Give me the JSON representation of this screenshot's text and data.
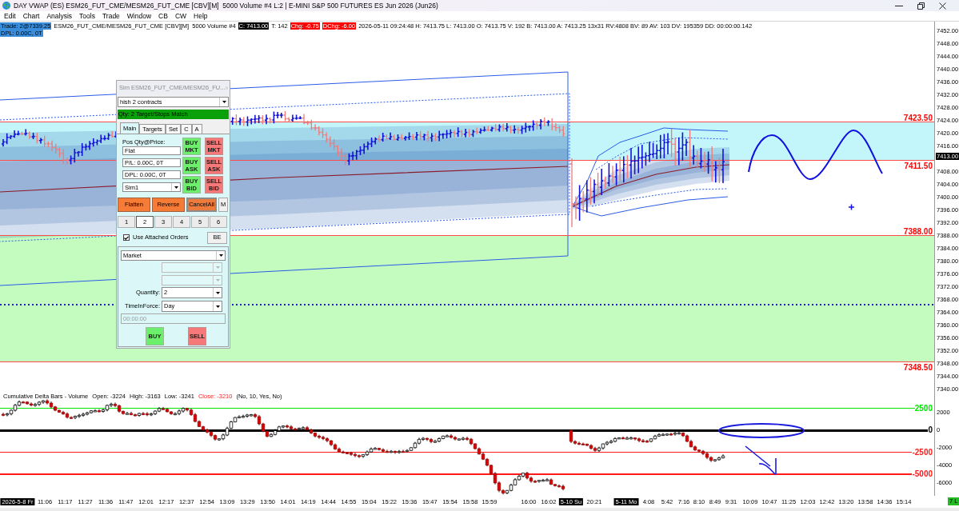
{
  "window": {
    "title": "DAY VWAP (ES) ESM26_FUT_CME/MESM26_FUT_CME [CBV][M]  5000 Volume #4 L:2 | E-MINI S&P 500 FUTURES ES Jun 2026 (Jun26)"
  },
  "menu": [
    "Edit",
    "Chart",
    "Analysis",
    "Tools",
    "Trade",
    "Window",
    "CB",
    "CW",
    "Help"
  ],
  "quote_bar": {
    "rows": [
      {
        "segments": [
          {
            "text": "Trade: 2@7339.25",
            "kind": "highlight"
          },
          {
            "text": "ESM26_FUT_CME/MESM26_FUT_CME [CBV][M]  5000 Volume #4",
            "kind": "plain"
          },
          {
            "text": "C: 7413.00",
            "kind": "inverse"
          },
          {
            "text": "T: 142",
            "kind": "plain"
          },
          {
            "text": "Chg: -0.75",
            "kind": "alert"
          },
          {
            "text": "DChg: -6.00",
            "kind": "alert"
          },
          {
            "text": "2026-05-11 09:24:48 H: 7413.75 L: 7413.00 O: 7413.75 V: 192 B: 7413.00 A: 7413.25 13x31 RV:4808 BV: 89 AV: 103 DV: 195359 DD: 00:00:00.142",
            "kind": "plain"
          }
        ]
      },
      {
        "segments": [
          {
            "text": "DPL: 0.00C, 0T",
            "kind": "highlight"
          }
        ]
      }
    ]
  },
  "price_chart": {
    "zones": [
      {
        "color": "#c2f6fa",
        "top_label": "7423.50",
        "bottom_label": "7411.50"
      },
      {
        "color": "#c4fcc0",
        "top_label": "7388.00",
        "bottom_label": "7348.50"
      }
    ],
    "axis_labels": [
      "7452.00",
      "7448.00",
      "7444.00",
      "7440.00",
      "7436.00",
      "7432.00",
      "7428.00",
      "7424.00",
      "7420.00",
      "7416.00",
      "7408.00",
      "7404.00",
      "7400.00",
      "7396.00",
      "7392.00",
      "7388.00",
      "7384.00",
      "7380.00",
      "7376.00",
      "7372.00",
      "7368.00",
      "7364.00",
      "7360.00",
      "7356.00",
      "7352.00",
      "7348.00",
      "7344.00",
      "7340.00"
    ],
    "last_price": "7413.00"
  },
  "order_panel": {
    "title": "Sim ESM26_FUT_CME/MESM26_FU...",
    "strategy": "hish 2 contracts",
    "status": "Qty: 2 Target/Stops Match",
    "tabs": [
      {
        "label": "Main",
        "selected": true
      },
      {
        "label": "Targets",
        "selected": false
      },
      {
        "label": "Set",
        "selected": false
      },
      {
        "label": "C",
        "selected": false
      },
      {
        "label": "A",
        "selected": false
      }
    ],
    "position_label": "Pos Qty@Price:",
    "position": "Flat",
    "pl": "P/L: 0.00C, 0T",
    "dpl": "DPL: 0.00C, 0T",
    "account": "Sim1",
    "quick_buttons": [
      {
        "label": "BUY MKT",
        "kind": "buy"
      },
      {
        "label": "SELL MKT",
        "kind": "sell"
      },
      {
        "label": "BUY ASK",
        "kind": "buy"
      },
      {
        "label": "SELL ASK",
        "kind": "sell"
      },
      {
        "label": "BUY BID",
        "kind": "buy"
      },
      {
        "label": "SELL BID",
        "kind": "sell"
      }
    ],
    "action_buttons": [
      {
        "label": "Flatten",
        "kind": "action"
      },
      {
        "label": "Reverse",
        "kind": "action"
      },
      {
        "label": "CancelAll",
        "kind": "default"
      },
      {
        "label": "M",
        "kind": "plain"
      }
    ],
    "bracket_tabs": [
      {
        "label": "1",
        "selected": false
      },
      {
        "label": "2",
        "selected": true
      },
      {
        "label": "3",
        "selected": false
      },
      {
        "label": "4",
        "selected": false
      },
      {
        "label": "5",
        "selected": false
      },
      {
        "label": "6",
        "selected": false
      }
    ],
    "attached_orders": {
      "label": "Use Attached Orders",
      "checked": true
    },
    "be_button": "BE",
    "order_type": "Market",
    "extra_dropdowns": [
      {
        "disabled": true
      },
      {
        "disabled": true
      }
    ],
    "quantity": {
      "label": "Quantity:",
      "value": "2"
    },
    "time_in_force": {
      "label": "TimeInForce:",
      "value": "Day"
    },
    "time_field": {
      "placeholder": "00:00:00",
      "disabled": true
    },
    "order_buttons": [
      {
        "label": "BUY",
        "kind": "buy"
      },
      {
        "label": "SELL",
        "kind": "sell"
      }
    ]
  },
  "indicator": {
    "legend": [
      {
        "text": "Cumulative Delta Bars - Volume",
        "kind": "plain"
      },
      {
        "text": "Open: -3224",
        "kind": "plain"
      },
      {
        "text": "High: -3163",
        "kind": "plain"
      },
      {
        "text": "Low: -3241",
        "kind": "plain"
      },
      {
        "text": "Close: -3210",
        "kind": "alert"
      },
      {
        "text": "(No, 10, Yes, No)",
        "kind": "plain"
      }
    ],
    "levels": [
      {
        "label": "2500",
        "color": "#00e600",
        "kind": "threshold"
      },
      {
        "label": "0",
        "color": "#000000",
        "kind": "baseline"
      },
      {
        "label": "-2500",
        "color": "#ff1a1a",
        "kind": "threshold"
      },
      {
        "label": "-5000",
        "color": "#ff1a1a",
        "kind": "threshold"
      }
    ],
    "axis_labels": [
      "2000",
      "0",
      "-2000",
      "-4000",
      "-6000"
    ]
  },
  "time_axis": {
    "labels": [
      {
        "text": "2026-5-8 Fr",
        "kind": "date"
      },
      {
        "text": "11:06",
        "kind": "time"
      },
      {
        "text": "11:17",
        "kind": "time"
      },
      {
        "text": "11:27",
        "kind": "time"
      },
      {
        "text": "11:36",
        "kind": "time"
      },
      {
        "text": "11:47",
        "kind": "time"
      },
      {
        "text": "12:01",
        "kind": "time"
      },
      {
        "text": "12:17",
        "kind": "time"
      },
      {
        "text": "12:37",
        "kind": "time"
      },
      {
        "text": "12:54",
        "kind": "time"
      },
      {
        "text": "13:09",
        "kind": "time"
      },
      {
        "text": "13:29",
        "kind": "time"
      },
      {
        "text": "13:50",
        "kind": "time"
      },
      {
        "text": "14:01",
        "kind": "time"
      },
      {
        "text": "14:19",
        "kind": "time"
      },
      {
        "text": "14:44",
        "kind": "time"
      },
      {
        "text": "14:55",
        "kind": "time"
      },
      {
        "text": "15:04",
        "kind": "time"
      },
      {
        "text": "15:22",
        "kind": "time"
      },
      {
        "text": "15:36",
        "kind": "time"
      },
      {
        "text": "15:47",
        "kind": "time"
      },
      {
        "text": "15:54",
        "kind": "time"
      },
      {
        "text": "15:58",
        "kind": "time"
      },
      {
        "text": "15:59",
        "kind": "time"
      },
      {
        "text": "16:00",
        "kind": "time"
      },
      {
        "text": "16:02",
        "kind": "time"
      },
      {
        "text": "5-10 Su",
        "kind": "date"
      },
      {
        "text": "20:21",
        "kind": "time"
      },
      {
        "text": "5-11 Mo",
        "kind": "date"
      },
      {
        "text": "4:08",
        "kind": "time"
      },
      {
        "text": "5:42",
        "kind": "time"
      },
      {
        "text": "7:16",
        "kind": "time"
      },
      {
        "text": "8:10",
        "kind": "time"
      },
      {
        "text": "8:49",
        "kind": "time"
      },
      {
        "text": "9:31",
        "kind": "time"
      },
      {
        "text": "10:09",
        "kind": "time"
      },
      {
        "text": "10:47",
        "kind": "time"
      },
      {
        "text": "11:25",
        "kind": "time"
      },
      {
        "text": "12:03",
        "kind": "time"
      },
      {
        "text": "12:42",
        "kind": "time"
      },
      {
        "text": "13:20",
        "kind": "time"
      },
      {
        "text": "13:58",
        "kind": "time"
      },
      {
        "text": "14:36",
        "kind": "time"
      },
      {
        "text": "15:14",
        "kind": "time"
      }
    ]
  },
  "status_badge": "7 L"
}
